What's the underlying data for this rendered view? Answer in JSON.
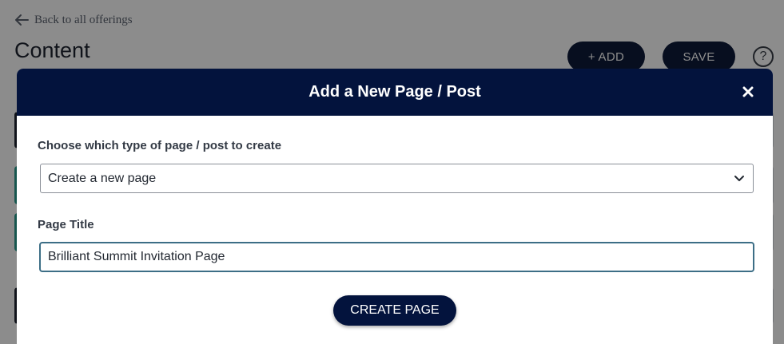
{
  "background": {
    "back_link": "Back to all offerings",
    "page_title": "Content",
    "add_button": "+ ADD",
    "save_button": "SAVE",
    "help_button": "?"
  },
  "modal": {
    "title": "Add a New Page / Post",
    "close_icon": "×",
    "type_label": "Choose which type of page / post to create",
    "type_select_value": "Create a new page",
    "title_label": "Page Title",
    "title_input_value": "Brilliant Summit Invitation Page",
    "create_button": "CREATE PAGE"
  },
  "colors": {
    "navy": "#03133d",
    "teal_accent": "#2a9d8f",
    "input_focus_border": "#3c6e86"
  }
}
